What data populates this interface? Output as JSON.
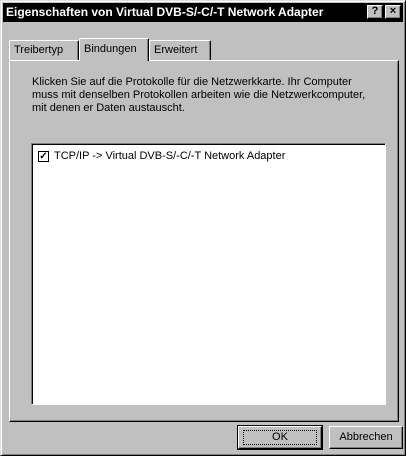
{
  "window": {
    "title": "Eigenschaften von Virtual DVB-S/-C/-T Network Adapter",
    "help_glyph": "?",
    "close_glyph": "×"
  },
  "tabs": [
    {
      "label": "Treibertyp",
      "selected": false
    },
    {
      "label": "Bindungen",
      "selected": true
    },
    {
      "label": "Erweitert",
      "selected": false
    }
  ],
  "panel": {
    "description": "Klicken Sie auf die Protokolle für die Netzwerkkarte. Ihr Computer muss mit denselben Protokollen arbeiten wie die Netzwerkcomputer, mit denen er Daten austauscht.",
    "items": [
      {
        "label": "TCP/IP -> Virtual DVB-S/-C/-T Network Adapter",
        "checked": true,
        "check_glyph": "✓"
      }
    ]
  },
  "buttons": {
    "ok": "OK",
    "cancel": "Abbrechen"
  }
}
